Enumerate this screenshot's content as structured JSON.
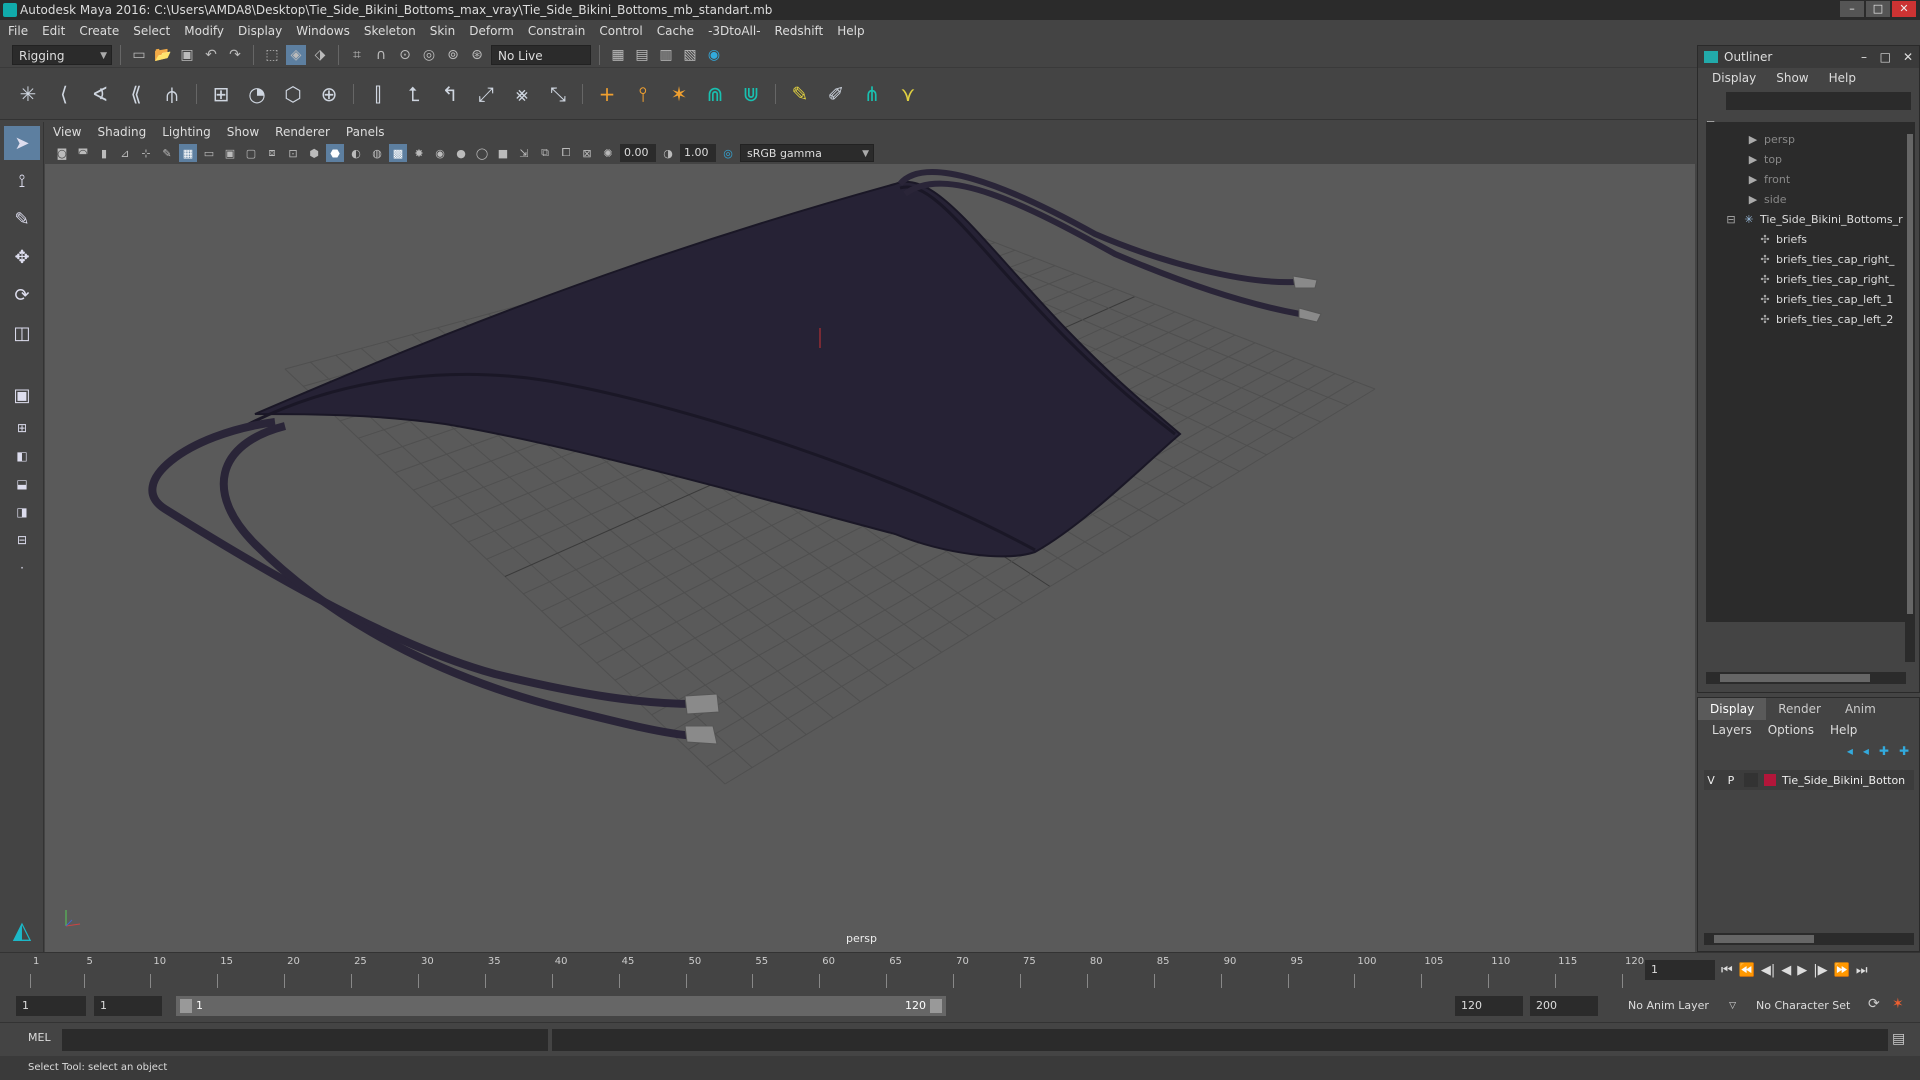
{
  "window": {
    "title": "Autodesk Maya 2016: C:\\Users\\AMDA8\\Desktop\\Tie_Side_Bikini_Bottoms_max_vray\\Tie_Side_Bikini_Bottoms_mb_standart.mb",
    "minimize": "–",
    "maximize": "□",
    "close": "✕"
  },
  "menubar": [
    "File",
    "Edit",
    "Create",
    "Select",
    "Modify",
    "Display",
    "Windows",
    "Skeleton",
    "Skin",
    "Deform",
    "Constrain",
    "Control",
    "Cache",
    "-3DtoAll-",
    "Redshift",
    "Help"
  ],
  "status": {
    "menuset": "Rigging",
    "live_surface": "No Live Surface"
  },
  "panel": {
    "menu": [
      "View",
      "Shading",
      "Lighting",
      "Show",
      "Renderer",
      "Panels"
    ],
    "exposure": "0.00",
    "gamma": "1.00",
    "colorspace": "sRGB gamma",
    "camera_label": "persp"
  },
  "outliner": {
    "title": "Outliner",
    "minimize": "–",
    "maximize": "□",
    "close": "✕",
    "menu": [
      "Display",
      "Show",
      "Help"
    ],
    "items": [
      {
        "label": "persp",
        "dim": true,
        "icon": "camera-icon"
      },
      {
        "label": "top",
        "dim": true,
        "icon": "camera-icon"
      },
      {
        "label": "front",
        "dim": true,
        "icon": "camera-icon"
      },
      {
        "label": "side",
        "dim": true,
        "icon": "camera-icon"
      },
      {
        "label": "Tie_Side_Bikini_Bottoms_r",
        "dim": false,
        "icon": "group-icon"
      },
      {
        "label": "briefs",
        "dim": false,
        "icon": "mesh-icon"
      },
      {
        "label": "briefs_ties_cap_right_",
        "dim": false,
        "icon": "mesh-icon"
      },
      {
        "label": "briefs_ties_cap_right_",
        "dim": false,
        "icon": "mesh-icon"
      },
      {
        "label": "briefs_ties_cap_left_1",
        "dim": false,
        "icon": "mesh-icon"
      },
      {
        "label": "briefs_ties_cap_left_2",
        "dim": false,
        "icon": "mesh-icon"
      }
    ]
  },
  "layers": {
    "tabs": [
      "Display",
      "Render",
      "Anim"
    ],
    "menu": [
      "Layers",
      "Options",
      "Help"
    ],
    "row": {
      "v": "V",
      "p": "P",
      "name": "Tie_Side_Bikini_Botton",
      "color": "#b3163a"
    }
  },
  "timeline": {
    "ticks": [
      "1",
      "5",
      "10",
      "15",
      "20",
      "25",
      "30",
      "35",
      "40",
      "45",
      "50",
      "55",
      "60",
      "65",
      "70",
      "75",
      "80",
      "85",
      "90",
      "95",
      "100",
      "105",
      "110",
      "115",
      "120"
    ],
    "current_frame": "1"
  },
  "range": {
    "start": "1",
    "playback_start": "1",
    "slider_start": "1",
    "slider_end": "120",
    "playback_end": "120",
    "end": "200",
    "anim_layer": "No Anim Layer",
    "char_set": "No Character Set"
  },
  "cmdline": {
    "label": "MEL"
  },
  "help": "Select Tool: select an object"
}
